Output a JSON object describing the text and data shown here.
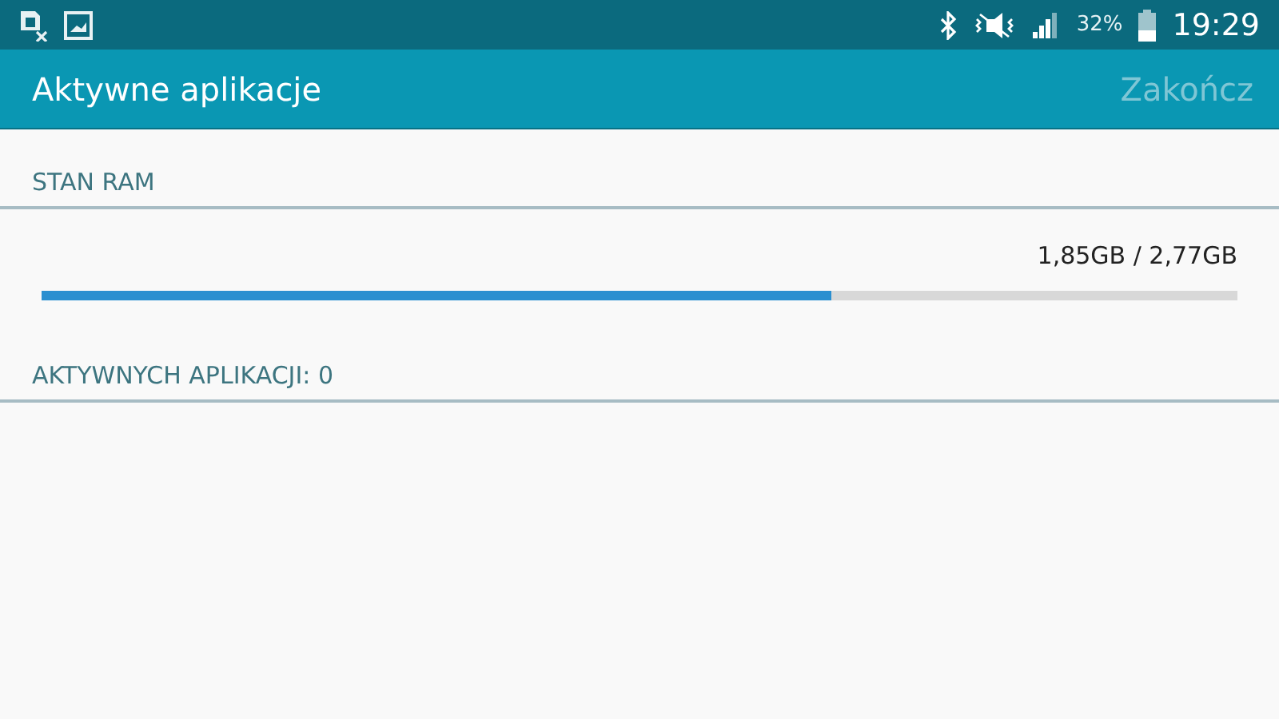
{
  "status_bar": {
    "battery": "32%",
    "time": "19:29"
  },
  "app_bar": {
    "title": "Aktywne aplikacje",
    "action": {
      "label": "Zakończ",
      "disabled": true
    }
  },
  "ram": {
    "header": "STAN RAM",
    "usage": "1,85GB / 2,77GB",
    "level": 0.66
  },
  "apps": {
    "header": "AKTYWNYCH APLIKACJI: 0"
  }
}
